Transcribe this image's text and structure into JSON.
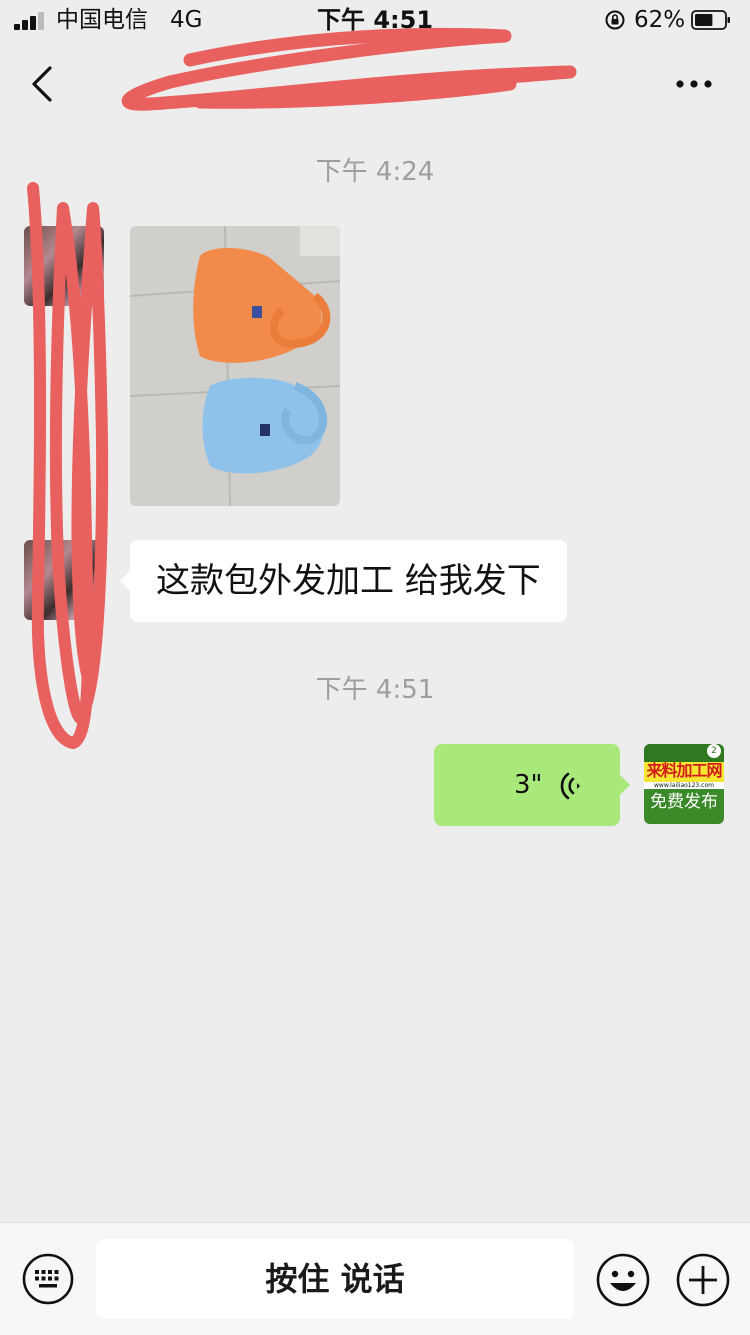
{
  "status_bar": {
    "carrier": "中国电信",
    "network": "4G",
    "time": "下午 4:51",
    "battery_percent": "62%",
    "battery_level": 0.62
  },
  "nav": {
    "title": "",
    "back_icon": "chevron-left-icon",
    "more_icon": "ellipsis-icon"
  },
  "messages": [
    {
      "type": "time",
      "text": "下午 4:24"
    },
    {
      "type": "image",
      "from": "friend",
      "image": "orange-and-blue-handbags-photo"
    },
    {
      "type": "text",
      "from": "friend",
      "text": "这款包外发加工 给我发下"
    },
    {
      "type": "time",
      "text": "下午 4:51"
    },
    {
      "type": "voice",
      "from": "me",
      "duration": "3\""
    }
  ],
  "my_avatar": {
    "title": "来料加工网",
    "url": "www.lailiao123.com",
    "badge": "免费发布"
  },
  "input_bar": {
    "talk_label": "按住 说话",
    "keyboard_icon": "keyboard-icon",
    "emoji_icon": "emoji-icon",
    "plus_icon": "plus-icon"
  },
  "colors": {
    "background": "#ededed",
    "outgoing_bubble": "#a9e87a",
    "incoming_bubble": "#ffffff",
    "redaction": "#e8615e",
    "timestamp": "#9e9e9e"
  }
}
